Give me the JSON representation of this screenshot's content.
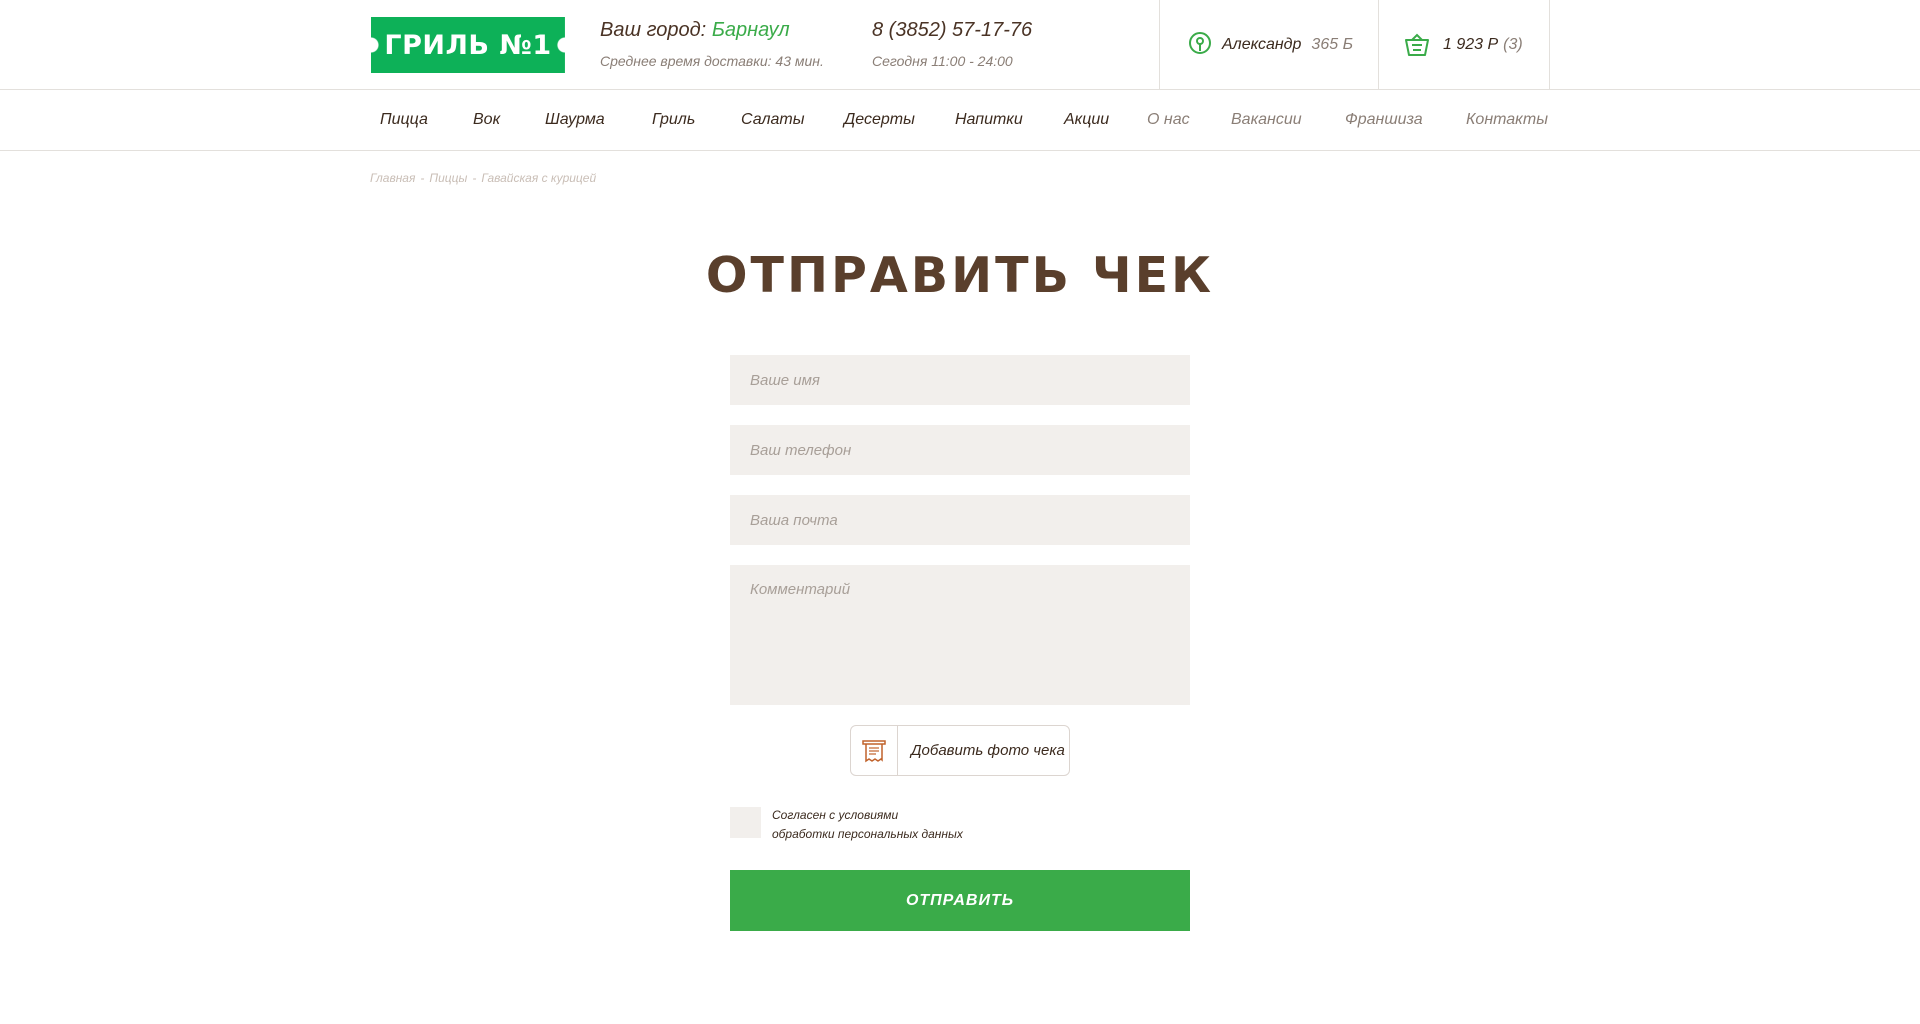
{
  "header": {
    "logo_text": "ГРИЛЬ №1",
    "city_label": "Ваш город:",
    "city_name": "Барнаул",
    "delivery_time": "Среднее время доставки: 43 мин.",
    "phone": "8 (3852) 57-17-76",
    "hours": "Сегодня 11:00 - 24:00",
    "user_name": "Александр",
    "user_points": "365 Б",
    "cart_sum": "1 923 Р",
    "cart_count": "(3)",
    "icons": {
      "user": "location-pin-icon",
      "cart": "basket-icon"
    }
  },
  "nav": {
    "items": [
      {
        "label": "Пицца"
      },
      {
        "label": "Вок"
      },
      {
        "label": "Шаурма"
      },
      {
        "label": "Гриль"
      },
      {
        "label": "Салаты"
      },
      {
        "label": "Десерты"
      },
      {
        "label": "Напитки"
      },
      {
        "label": "Акции"
      },
      {
        "label": "О нас"
      },
      {
        "label": "Вакансии"
      },
      {
        "label": "Франшиза"
      },
      {
        "label": "Контакты"
      }
    ]
  },
  "breadcrumb": [
    "Главная",
    "Пиццы",
    "Гавайская с курицей"
  ],
  "page": {
    "title": "ОТПРАВИТЬ ЧЕК"
  },
  "form": {
    "name_placeholder": "Ваше имя",
    "phone_placeholder": "Ваш телефон",
    "email_placeholder": "Ваша почта",
    "comment_placeholder": "Комментарий",
    "add_photo_label": "Добавить фото чека",
    "agree_line1": "Согласен с условиями",
    "agree_line2": "обработки персональных данных",
    "submit_label": "ОТПРАВИТЬ"
  },
  "colors": {
    "brand_green": "#0db158",
    "accent_green": "#3aab49",
    "title_brown": "#5a3f2c",
    "field_bg": "#f2efec"
  }
}
